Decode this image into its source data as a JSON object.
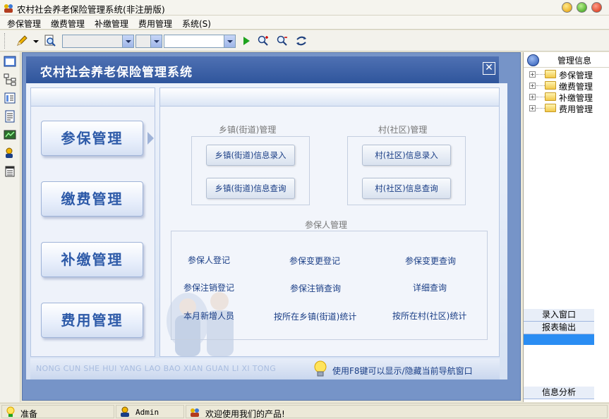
{
  "window": {
    "title": "农村社会养老保险管理系统(非注册版)"
  },
  "menu": {
    "items": [
      "参保管理",
      "缴费管理",
      "补缴管理",
      "费用管理",
      "系统(S)"
    ]
  },
  "main": {
    "title": "农村社会养老保险管理系统",
    "close_label": "✕",
    "nav_buttons": [
      "参保管理",
      "缴费管理",
      "补缴管理",
      "费用管理"
    ],
    "town_group": {
      "label": "乡镇(街道)管理",
      "buttons": [
        "乡镇(街道)信息录入",
        "乡镇(街道)信息查询"
      ]
    },
    "village_group": {
      "label": "村(社区)管理",
      "buttons": [
        "村(社区)信息录入",
        "村(社区)信息查询"
      ]
    },
    "insured_group": {
      "label": "参保人管理",
      "links": [
        "参保人登记",
        "参保变更登记",
        "参保变更查询",
        "参保注销登记",
        "参保注销查询",
        "详细查询",
        "本月新增人员",
        "按所在乡镇(街道)统计",
        "按所在村(社区)统计"
      ]
    },
    "footer_pinyin": "NONG CUN SHE HUI YANG LAO BAO XIAN GUAN LI XI TONG",
    "footer_hint": "使用F8键可以显示/隐藏当前导航窗口"
  },
  "right_panel": {
    "title": "管理信息",
    "tree": [
      "参保管理",
      "缴费管理",
      "补缴管理",
      "费用管理"
    ],
    "buttons": [
      "录入窗口",
      "报表输出",
      "信息分析"
    ]
  },
  "status": {
    "ready": "准备",
    "user": "Admin",
    "message": "欢迎使用我们的产品!"
  },
  "colors": {
    "header_blue": "#2f559c",
    "link_blue": "#1a3e86",
    "selection_blue": "#2a8df3"
  }
}
